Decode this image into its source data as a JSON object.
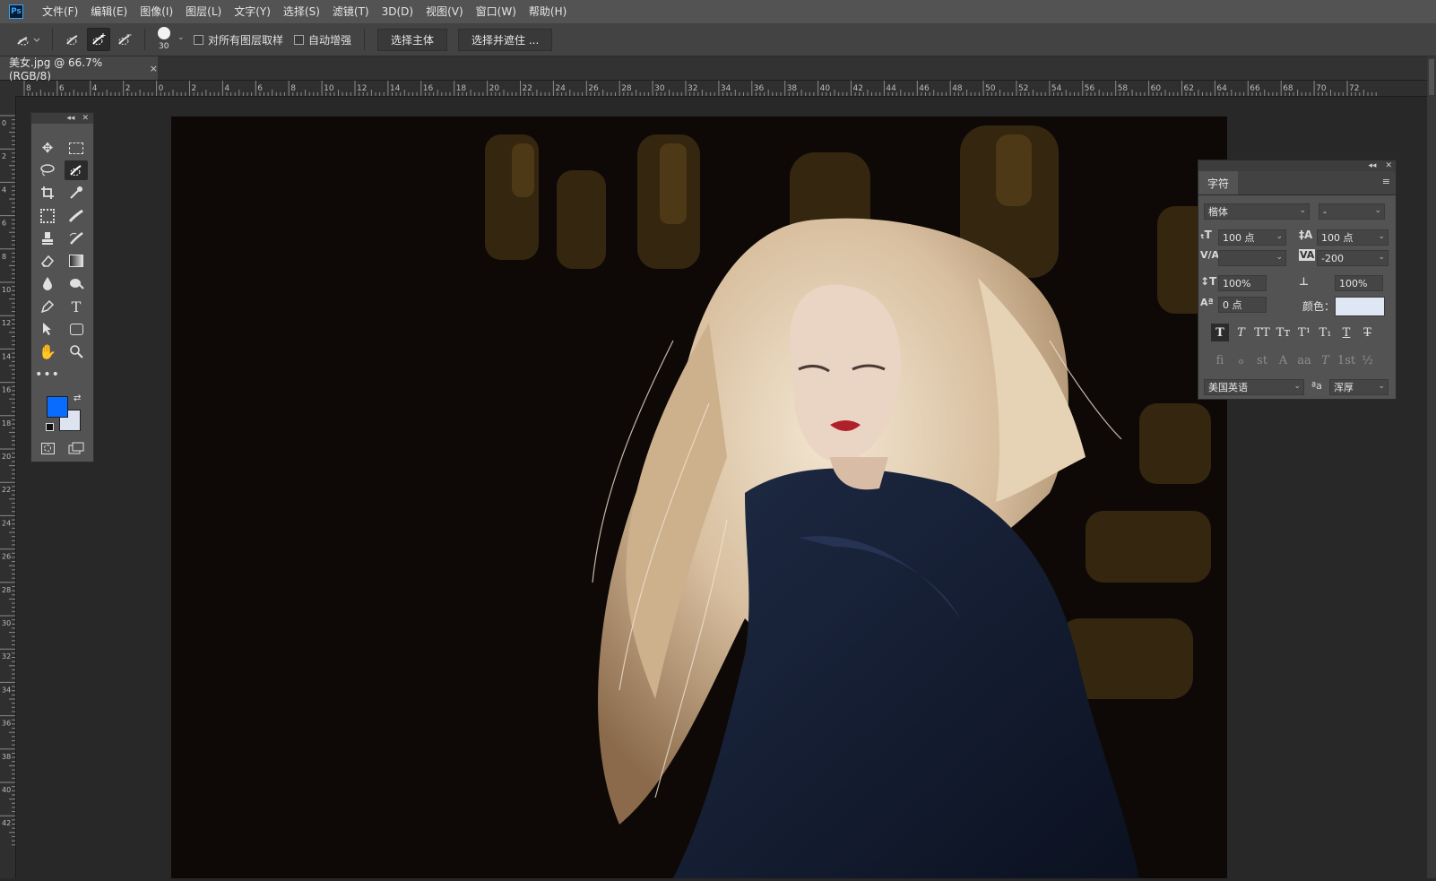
{
  "app": {
    "name": "Photoshop",
    "logo_text": "Ps"
  },
  "menu": [
    "文件(F)",
    "编辑(E)",
    "图像(I)",
    "图层(L)",
    "文字(Y)",
    "选择(S)",
    "滤镜(T)",
    "3D(D)",
    "视图(V)",
    "窗口(W)",
    "帮助(H)"
  ],
  "options": {
    "brush_size": "30",
    "sample_all_layers": "对所有图层取样",
    "auto_enhance": "自动增强",
    "select_subject": "选择主体",
    "select_and_mask": "选择并遮住 ..."
  },
  "document": {
    "tab_title": "美女.jpg @ 66.7%(RGB/8)",
    "close": "×"
  },
  "ruler": {
    "h_labels": [
      "8",
      "6",
      "4",
      "2",
      "0",
      "2",
      "4",
      "6",
      "8",
      "10",
      "12",
      "14",
      "16",
      "18",
      "20",
      "22",
      "24",
      "26",
      "28",
      "30",
      "32",
      "34",
      "36",
      "38",
      "40",
      "42",
      "44",
      "46",
      "48",
      "50",
      "52",
      "54",
      "56",
      "58",
      "60",
      "62",
      "64",
      "66",
      "68",
      "70",
      "72"
    ],
    "v_labels": [
      "0",
      "2",
      "4",
      "6",
      "8",
      "10",
      "12",
      "14",
      "16",
      "18",
      "20",
      "22",
      "24",
      "26",
      "28",
      "30",
      "32",
      "34",
      "36",
      "38",
      "40",
      "42"
    ]
  },
  "colors": {
    "foreground": "#0a6cff",
    "background": "#dde4ef"
  },
  "character_panel": {
    "tab": "字符",
    "font_family": "楷体",
    "font_style": "-",
    "font_size": "100 点",
    "leading": "100 点",
    "kerning": "",
    "tracking": "-200",
    "vertical_scale": "100%",
    "horizontal_scale": "100%",
    "baseline_shift": "0 点",
    "color_label": "颜色：",
    "color_value": "#dfe7f4",
    "language": "美国英语",
    "aa_label": "ªa",
    "antialias": "浑厚",
    "style_buttons": [
      "T",
      "T",
      "TT",
      "Tт",
      "T¹",
      "T₁",
      "T",
      "T"
    ],
    "opentype_buttons": [
      "fi",
      "ℴ",
      "st",
      "A",
      "aa",
      "T",
      "1st",
      "½"
    ]
  }
}
